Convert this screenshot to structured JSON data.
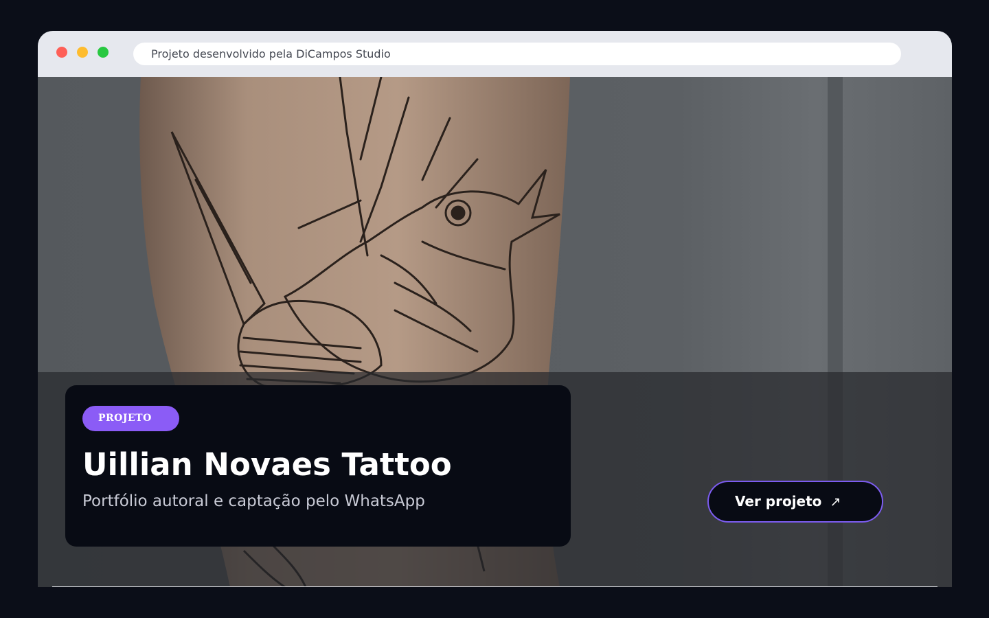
{
  "browser": {
    "address_text": "Projeto desenvolvido pela DiCampos Studio",
    "controls": [
      "close",
      "minimize",
      "maximize"
    ]
  },
  "hero": {
    "image": "tattoo-bird-photo",
    "card": {
      "badge": "PROJETO",
      "title": "Uillian Novaes Tattoo",
      "subtitle": "Portfólio autoral e captação pelo WhatsApp"
    },
    "cta": {
      "label": "Ver projeto",
      "icon": "arrow-up-right-icon",
      "icon_glyph": "↗"
    }
  },
  "colors": {
    "accent": "#8b5cf6",
    "card_bg": "#080b14",
    "page_bg": "#0b0e18"
  }
}
